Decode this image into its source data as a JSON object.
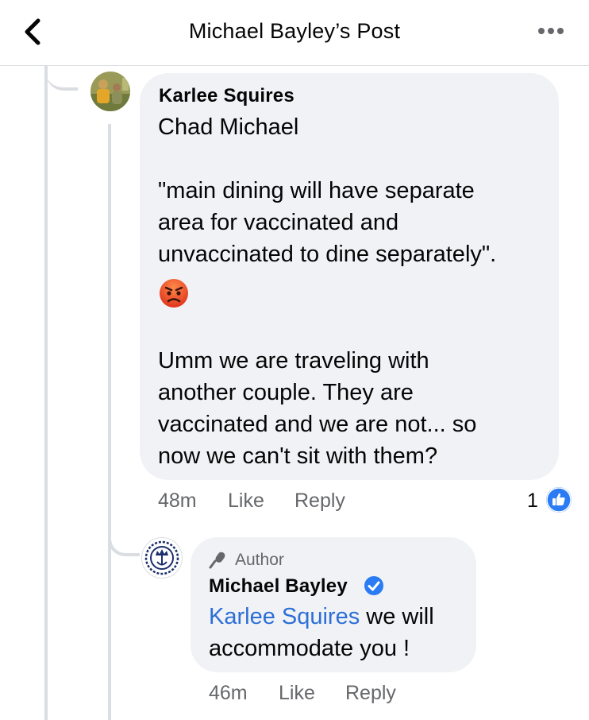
{
  "header": {
    "title": "Michael Bayley’s Post"
  },
  "comment": {
    "author": "Karlee Squires",
    "mention": "Chad Michael",
    "paragraph1_lines": [
      "\"main dining will have separate",
      "area for vaccinated and",
      "unvaccinated to dine separately\"."
    ],
    "emoji": "angry-face",
    "paragraph2_lines": [
      "Umm we are traveling with",
      "another couple. They are",
      "vaccinated and we are not... so",
      "now we can't sit with them?"
    ],
    "time": "48m",
    "like_label": "Like",
    "reply_label": "Reply",
    "reaction_count": "1"
  },
  "reply": {
    "badge_label": "Author",
    "author": "Michael Bayley",
    "mention": "Karlee Squires",
    "text_after_mention": " we will",
    "text_line2": "accommodate you !",
    "time": "46m",
    "like_label": "Like",
    "reply_label": "Reply"
  },
  "colors": {
    "link": "#2d6fd6",
    "like_blue": "#2a7bf4",
    "bubble": "#f0f2f5",
    "muted": "#65676b"
  }
}
